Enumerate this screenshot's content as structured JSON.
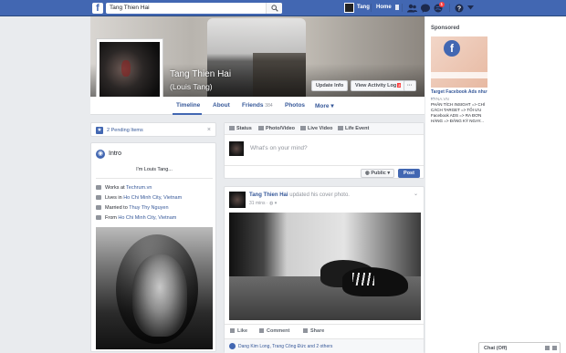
{
  "topbar": {
    "logo": "f",
    "search_value": "Tang Thien Hai",
    "user_name": "Tang",
    "home_label": "Home",
    "notification_count": "1"
  },
  "profile": {
    "name": "Tang Thien Hai",
    "alternate_name": "(Louis Tang)",
    "update_info_label": "Update Info",
    "activity_log_label": "View Activity Log",
    "activity_log_badge": "2",
    "more_label": "···"
  },
  "tabs": [
    {
      "label": "Timeline"
    },
    {
      "label": "About"
    },
    {
      "label": "Friends",
      "count": "384"
    },
    {
      "label": "Photos"
    },
    {
      "label": "More ▾"
    }
  ],
  "pending": {
    "label": "2 Pending Items",
    "close": "×"
  },
  "intro": {
    "title": "Intro",
    "bio": "I'm Louis Tang...",
    "works_prefix": "Works at",
    "works_link": "Techrum.vn",
    "lives_prefix": "Lives in",
    "lives_link": "Ho Chi Minh City, Vietnam",
    "married_prefix": "Married to",
    "married_link": "Thuy Thy Nguyen",
    "from_prefix": "From",
    "from_link": "Ho Chi Minh City, Vietnam"
  },
  "composer": {
    "tabs": [
      "Status",
      "Photo/Video",
      "Live Video",
      "Life Event"
    ],
    "placeholder": "What's on your mind?",
    "privacy_label": "Public ▾",
    "post_label": "Post"
  },
  "post": {
    "author": "Tang Thien Hai",
    "action": "updated his cover photo.",
    "time": "31 mins · ",
    "like_label": "Like",
    "comment_label": "Comment",
    "share_label": "Share",
    "likers": "Dang Kim Long, Trang Công Đức and 2 others"
  },
  "sponsored": {
    "heading": "Sponsored",
    "ad_title": "Target Facebook Ads như ...",
    "ad_site": "KYNA.VN",
    "ad_desc": "PHÂN TÍCH INSIGHT => CHÍ CÁCH TARGET => TỐI ƯU Facebook ADS => RA ĐƠN HÀNG => ĐĂNG KÝ NGAY..."
  },
  "chat": {
    "label": "Chat (Off)"
  },
  "colors": {
    "facebook_blue": "#4267b2",
    "link_blue": "#365899",
    "page_bg": "#e9ebee",
    "badge_red": "#fa3e3e"
  }
}
